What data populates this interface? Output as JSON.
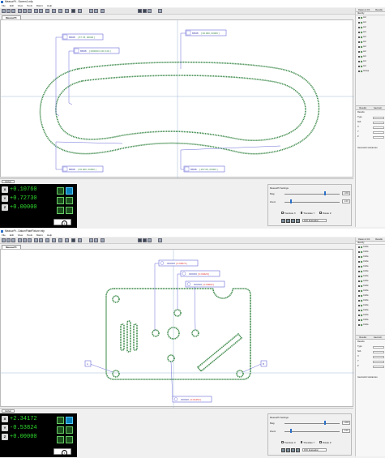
{
  "windows": [
    {
      "title": "MeasurPt - Screen1.mfp",
      "menu": [
        "File",
        "Edit",
        "View",
        "Tools",
        "Macro",
        "Help"
      ],
      "doc_tab": "MeasurPt",
      "right_panel": {
        "tabs": [
          "Datum & Ch.",
          "Results"
        ],
        "header": "Identity",
        "items": [
          "Arc",
          "Arc",
          "Arc",
          "Arc",
          "Arc",
          "Arc",
          "Arc",
          "Arc",
          "Arc",
          "Arc",
          "Arc",
          "Group"
        ],
        "results_tabs": [
          "Results",
          "Geometr."
        ],
        "results_rows": [
          "Results",
          "Type",
          "N/A",
          "X",
          "Y",
          "Z"
        ],
        "geom_label": "Geometric tolerances"
      },
      "callouts": [
        {
          "label": "BB0B",
          "value": "[ 57.78, 00000 ]"
        },
        {
          "label": "BB0B",
          "value": "[ 000000 0.00 0.00 ]"
        },
        {
          "label": "BB0B",
          "value": "[ 00.000, 00000 ]"
        },
        {
          "label": "BB0B",
          "value": "[ 00.000, 00000 ]"
        },
        {
          "label": "BB0B",
          "value": "[ 207.00, 00000 ]"
        }
      ],
      "dro": {
        "tab": "Global",
        "axes": [
          {
            "label": "X",
            "value": "+0.10760"
          },
          {
            "label": "Y",
            "value": "+0.72730"
          },
          {
            "label": "Z",
            "value": "+0.00000"
          }
        ]
      },
      "settings": {
        "title": "MeasurPt Settings",
        "rows": [
          {
            "label": "Mag",
            "value": "1.000",
            "level": 0.72
          },
          {
            "label": "Zoom",
            "value": "1.00",
            "level": 0.1
          }
        ],
        "checkboxes": [
          "Translate X",
          "Translate Y",
          "Rotate Z"
        ],
        "dropdown": "DXF Evaluation"
      }
    },
    {
      "title": "MeasurPt - DatumPlateFixture.mfp",
      "menu": [
        "File",
        "Edit",
        "View",
        "Tools",
        "Macro",
        "Help"
      ],
      "doc_tab": "MeasurPt",
      "right_panel": {
        "tabs": [
          "Datum & Ch.",
          "Results"
        ],
        "header": "Identity",
        "items": [
          "Circle",
          "Circle",
          "Circle",
          "Circle",
          "Circle",
          "Circle",
          "Circle",
          "Circle",
          "Circle",
          "Circle",
          "Circle",
          "Circle",
          "Circle",
          "Circle",
          "Circle",
          "Circle",
          "Circle"
        ],
        "results_tabs": [
          "Results",
          "Geometr."
        ],
        "results_rows": [
          "Results",
          "Type",
          "N/A",
          "X",
          "Y",
          "Z"
        ],
        "geom_label": "Geometric tolerances"
      },
      "callouts": [
        {
          "label": "000000",
          "value": "[ 0.00071 ]"
        },
        {
          "label": "000000",
          "value": "[ 0.00420 ]"
        },
        {
          "label": "000000",
          "value": "[ 0.00602 ]"
        },
        {
          "label": "000000",
          "value": "[ 0.01252 ]"
        },
        {
          "label": "A",
          "value": ""
        },
        {
          "label": "B",
          "value": ""
        }
      ],
      "dro": {
        "tab": "Global",
        "axes": [
          {
            "label": "X",
            "value": "+2.34172"
          },
          {
            "label": "Y",
            "value": "-0.53824"
          },
          {
            "label": "Z",
            "value": "+0.00000"
          }
        ]
      },
      "settings": {
        "title": "MeasurPt Settings",
        "rows": [
          {
            "label": "Mag",
            "value": "1.000",
            "level": 0.72
          },
          {
            "label": "Zoom",
            "value": "1.00",
            "level": 0.1
          }
        ],
        "checkboxes": [
          "Translate X",
          "Translate Y",
          "Rotate Z"
        ],
        "dropdown": "DXF Evaluation"
      }
    }
  ],
  "colors": {
    "outline": "#3d8a4a",
    "callout_border": "#6a6ad8",
    "dro_text": "#2fdf2f",
    "deviation_text": "#e03030"
  }
}
